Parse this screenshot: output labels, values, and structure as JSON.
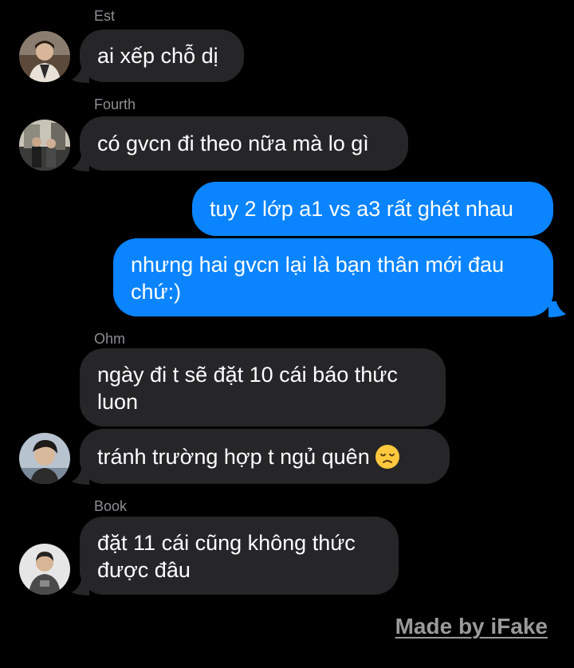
{
  "messages": [
    {
      "sender": "Est",
      "text": "ai xếp chỗ dị"
    },
    {
      "sender": "Fourth",
      "text": "có gvcn đi theo nữa mà lo gì"
    },
    {
      "sender": "",
      "text": "tuy 2 lớp a1 vs a3 rất ghét nhau"
    },
    {
      "sender": "",
      "text": "nhưng hai gvcn lại là bạn thân mới đau chứ:)"
    },
    {
      "sender": "Ohm",
      "text": "ngày đi t sẽ đặt 10 cái báo thức luon"
    },
    {
      "sender": "Ohm",
      "text": "tránh trường hợp t ngủ quên"
    },
    {
      "sender": "Book",
      "text": "đặt 11 cái cũng không thức được đâu"
    }
  ],
  "emoji_icon": "disappointed-face-icon",
  "watermark": "Made by iFake",
  "colors": {
    "background": "#000000",
    "incoming_bubble": "#262628",
    "outgoing_bubble": "#0a84ff",
    "sender_name": "#8e8e93"
  }
}
